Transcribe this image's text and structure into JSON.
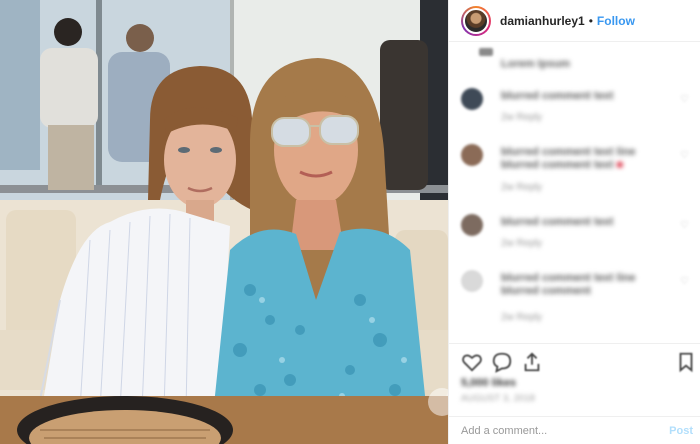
{
  "header": {
    "username": "damianhurley1",
    "separator": "•",
    "follow_label": "Follow"
  },
  "comments": [
    {
      "line1": "Lorem Ipsum",
      "meta": "",
      "avatar_color": "#8a8a8a"
    },
    {
      "line1": "blurred comment text",
      "meta": "2w Reply",
      "avatar_color": "#3f4a57"
    },
    {
      "line1": "blurred comment text line",
      "line2": "blurred comment text",
      "meta": "2w Reply",
      "avatar_color": "#8b6b57"
    },
    {
      "line1": "blurred comment text",
      "meta": "2w Reply",
      "avatar_color": "#7d6b60"
    },
    {
      "line1": "blurred comment text line",
      "line2": "blurred comment",
      "meta": "2w Reply",
      "avatar_color": "#d9d9d9"
    }
  ],
  "footer": {
    "likes": "5,000 likes",
    "date": "AUGUST 3, 2018",
    "comment_placeholder": "Add a comment...",
    "post_label": "Post"
  },
  "colors": {
    "link": "#3897f0",
    "post_disabled": "#b2dffc",
    "border": "#efefef"
  }
}
